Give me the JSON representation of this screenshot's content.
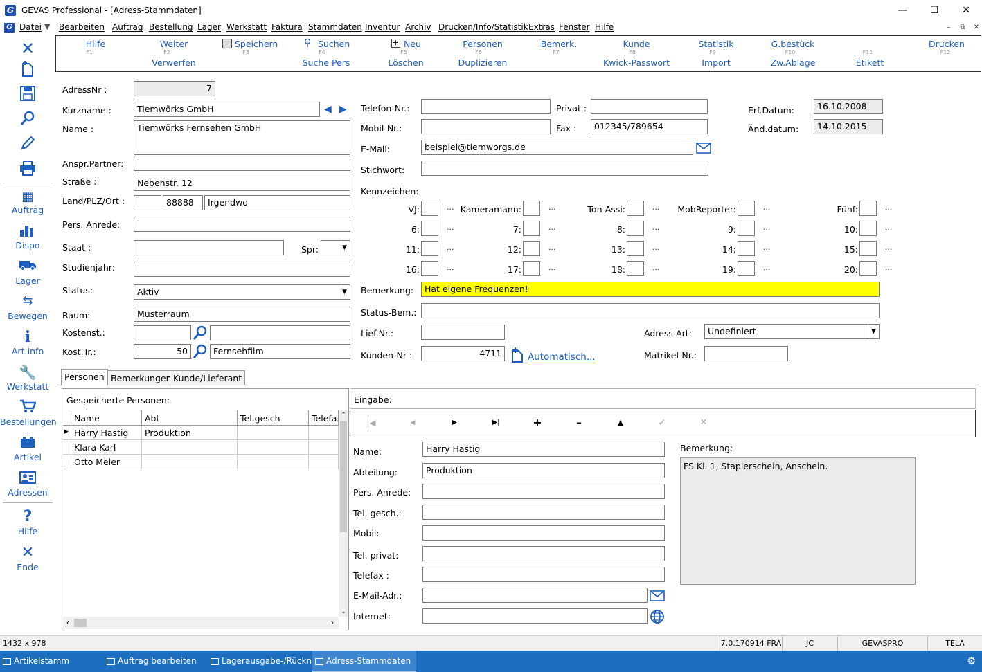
{
  "window": {
    "title": "GEVAS Professional - [Adress-Stammdaten]",
    "icon": "gevas-app-icon"
  },
  "menu": {
    "items": [
      "Datei",
      "Bearbeiten",
      "Auftrag",
      "Bestellung",
      "Lager",
      "Werkstatt",
      "Faktura",
      "Stammdaten",
      "Inventur",
      "Archiv",
      "Drucken/Info/Statistik",
      "Extras",
      "Fenster",
      "Hilfe"
    ]
  },
  "sidebar": {
    "top_icons": [
      "close-icon",
      "new-document-icon",
      "save-icon",
      "search-icon",
      "edit-pencil-icon",
      "print-icon"
    ],
    "items": [
      {
        "label": "Auftrag",
        "icon": "order-icon"
      },
      {
        "label": "Dispo",
        "icon": "bar-chart-icon"
      },
      {
        "label": "Lager",
        "icon": "truck-icon"
      },
      {
        "label": "Bewegen",
        "icon": "move-icon"
      },
      {
        "label": "Art.Info",
        "icon": "info-icon"
      },
      {
        "label": "Werkstatt",
        "icon": "wrench-icon"
      },
      {
        "label": "Bestellungen",
        "icon": "cart-icon"
      },
      {
        "label": "Artikel",
        "icon": "box-icon"
      },
      {
        "label": "Adressen",
        "icon": "address-card-icon"
      },
      {
        "label": "Hilfe",
        "icon": "question-icon"
      },
      {
        "label": "Ende",
        "icon": "exit-icon"
      }
    ]
  },
  "fkeys": [
    {
      "label": "Hilfe",
      "key": "F1",
      "sub": ""
    },
    {
      "label": "Weiter",
      "key": "F2",
      "sub": "Verwerfen"
    },
    {
      "label": "Speichern",
      "key": "F3",
      "sub": ""
    },
    {
      "label": "Suchen",
      "key": "F4",
      "sub": "Suche Pers"
    },
    {
      "label": "Neu",
      "key": "F5",
      "sub": "Löschen"
    },
    {
      "label": "Personen",
      "key": "F6",
      "sub": "Duplizieren"
    },
    {
      "label": "Bemerk.",
      "key": "F7",
      "sub": ""
    },
    {
      "label": "Kunde",
      "key": "F8",
      "sub": "Kwick-Passwort"
    },
    {
      "label": "Statistik",
      "key": "F9",
      "sub": "Import"
    },
    {
      "label": "G.bestück",
      "key": "F10",
      "sub": "Zw.Ablage"
    },
    {
      "label": "",
      "key": "F11",
      "sub": "Etikett"
    },
    {
      "label": "Drucken",
      "key": "F12",
      "sub": ""
    }
  ],
  "form": {
    "adressnr": {
      "label": "AdressNr :",
      "value": "7"
    },
    "kurzname": {
      "label": "Kurzname :",
      "value": "Tiemwörks GmbH"
    },
    "name": {
      "label": "Name :",
      "value": "Tiemwörks Fernsehen GmbH"
    },
    "anspr": {
      "label": "Anspr.Partner:",
      "value": ""
    },
    "strasse": {
      "label": "Straße :",
      "value": "Nebenstr. 12"
    },
    "land_plz_ort": {
      "label": "Land/PLZ/Ort :",
      "land": "",
      "plz": "88888",
      "ort": "Irgendwo"
    },
    "pers_anrede": {
      "label": "Pers. Anrede:",
      "value": ""
    },
    "staat": {
      "label": "Staat :",
      "value": ""
    },
    "spr": {
      "label": "Spr:",
      "value": ""
    },
    "studienjahr": {
      "label": "Studienjahr:",
      "value": ""
    },
    "status": {
      "label": "Status:",
      "value": "Aktiv"
    },
    "raum": {
      "label": "Raum:",
      "value": "Musterraum"
    },
    "kostenst": {
      "label": "Kostenst.:",
      "value": "",
      "desc": ""
    },
    "kosttr": {
      "label": "Kost.Tr.:",
      "value": "50",
      "desc": "Fernsehfilm"
    },
    "telefon": {
      "label": "Telefon-Nr.:",
      "value": ""
    },
    "privat": {
      "label": "Privat :",
      "value": ""
    },
    "mobil": {
      "label": "Mobil-Nr.:",
      "value": ""
    },
    "fax": {
      "label": "Fax :",
      "value": "012345/789654"
    },
    "email": {
      "label": "E-Mail:",
      "value": "beispiel@tiemworgs.de"
    },
    "stichwort": {
      "label": "Stichwort:",
      "value": ""
    },
    "erf_datum": {
      "label": "Erf.Datum:",
      "value": "16.10.2008"
    },
    "aend_datum": {
      "label": "Änd.datum:",
      "value": "14.10.2015"
    },
    "kennzeichen_label": "Kennzeichen:",
    "kennzeichen": [
      [
        "VJ:",
        "Kameramann:",
        "Ton-Assi:",
        "MobReporter:",
        "Fünf:"
      ],
      [
        "6:",
        "7:",
        "8:",
        "9:",
        "10:"
      ],
      [
        "11:",
        "12:",
        "13:",
        "14:",
        "15:"
      ],
      [
        "16:",
        "17:",
        "18:",
        "19:",
        "20:"
      ]
    ],
    "dots": "...",
    "bemerkung": {
      "label": "Bemerkung:",
      "value": "Hat eigene Frequenzen!"
    },
    "status_bem": {
      "label": "Status-Bem.:",
      "value": ""
    },
    "lief_nr": {
      "label": "Lief.Nr.:",
      "value": ""
    },
    "adress_art": {
      "label": "Adress-Art:",
      "value": "Undefiniert"
    },
    "kunden_nr": {
      "label": "Kunden-Nr :",
      "value": "4711"
    },
    "automatisch": "Automatisch...",
    "matrikel": {
      "label": "Matrikel-Nr.:",
      "value": ""
    }
  },
  "tabs": [
    "Personen",
    "Bemerkungen",
    "Kunde/Lieferant"
  ],
  "persons": {
    "title": "Gespeicherte Personen:",
    "columns": [
      "Name",
      "Abt",
      "Tel.gesch",
      "Telefax"
    ],
    "rows": [
      [
        "Harry Hastig",
        "Produktion",
        "",
        ""
      ],
      [
        "Klara Karl",
        "",
        "",
        ""
      ],
      [
        "Otto Meier",
        "",
        "",
        ""
      ]
    ]
  },
  "entry": {
    "title": "Eingabe:",
    "nav": [
      "first-record-icon",
      "prev-record-icon",
      "next-record-icon",
      "last-record-icon",
      "add-record-icon",
      "delete-record-icon",
      "move-up-icon",
      "confirm-icon",
      "cancel-icon"
    ],
    "name": {
      "label": "Name:",
      "value": "Harry Hastig"
    },
    "abteilung": {
      "label": "Abteilung:",
      "value": "Produktion"
    },
    "pers_anrede": {
      "label": "Pers. Anrede:",
      "value": ""
    },
    "tel_gesch": {
      "label": "Tel. gesch.:",
      "value": ""
    },
    "mobil": {
      "label": "Mobil:",
      "value": ""
    },
    "tel_privat": {
      "label": "Tel. privat:",
      "value": ""
    },
    "telefax": {
      "label": "Telefax :",
      "value": ""
    },
    "email": {
      "label": "E-Mail-Adr.:",
      "value": ""
    },
    "internet": {
      "label": "Internet:",
      "value": ""
    },
    "bemerkung_label": "Bemerkung:",
    "bemerkung": "FS Kl. 1, Staplerschein, Anschein."
  },
  "statusbar": {
    "size": "1432 x 978",
    "version": "7.0.170914 FRA",
    "user": "JC",
    "db": "GEVASPRO",
    "app": "TELA"
  },
  "taskbar": [
    "Artikelstamm",
    "Auftrag bearbeiten",
    "Lagerausgabe-/Rückn...",
    "Adress-Stammdaten"
  ],
  "colors": {
    "accent": "#1f5fbf",
    "highlight": "#ffff00",
    "taskbar": "#1e6ebf"
  }
}
